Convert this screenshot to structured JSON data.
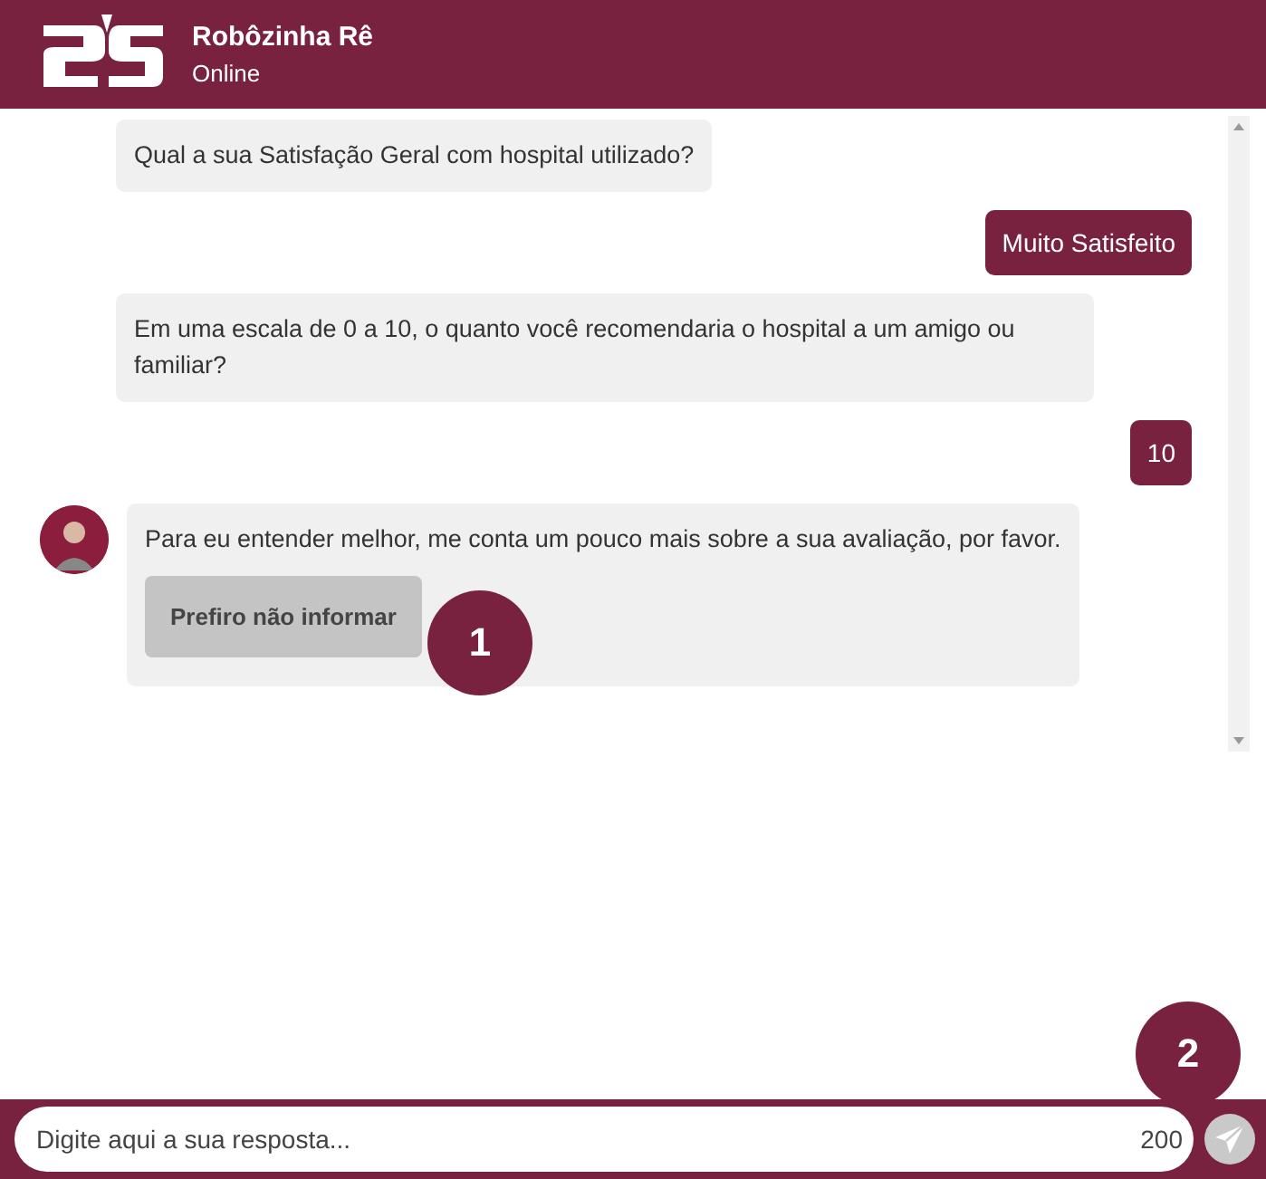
{
  "header": {
    "title": "Robôzinha Rê",
    "status": "Online"
  },
  "messages": [
    {
      "kind": "bot",
      "avatar": false,
      "text": "Qual a sua Satisfação Geral com hospital utilizado?"
    },
    {
      "kind": "user",
      "text": "Muito Satisfeito"
    },
    {
      "kind": "bot",
      "avatar": false,
      "text": "Em uma escala de 0 a 10, o quanto você recomendaria o hospital a um amigo ou familiar?"
    },
    {
      "kind": "user",
      "text": "10"
    },
    {
      "kind": "bot",
      "avatar": true,
      "text": "Para eu entender melhor, me conta um pouco mais sobre a sua avaliação, por favor.",
      "options": [
        "Prefiro não informar"
      ]
    }
  ],
  "input": {
    "placeholder": "Digite aqui a sua resposta...",
    "counter": "200"
  },
  "callouts": [
    "1",
    "2"
  ]
}
